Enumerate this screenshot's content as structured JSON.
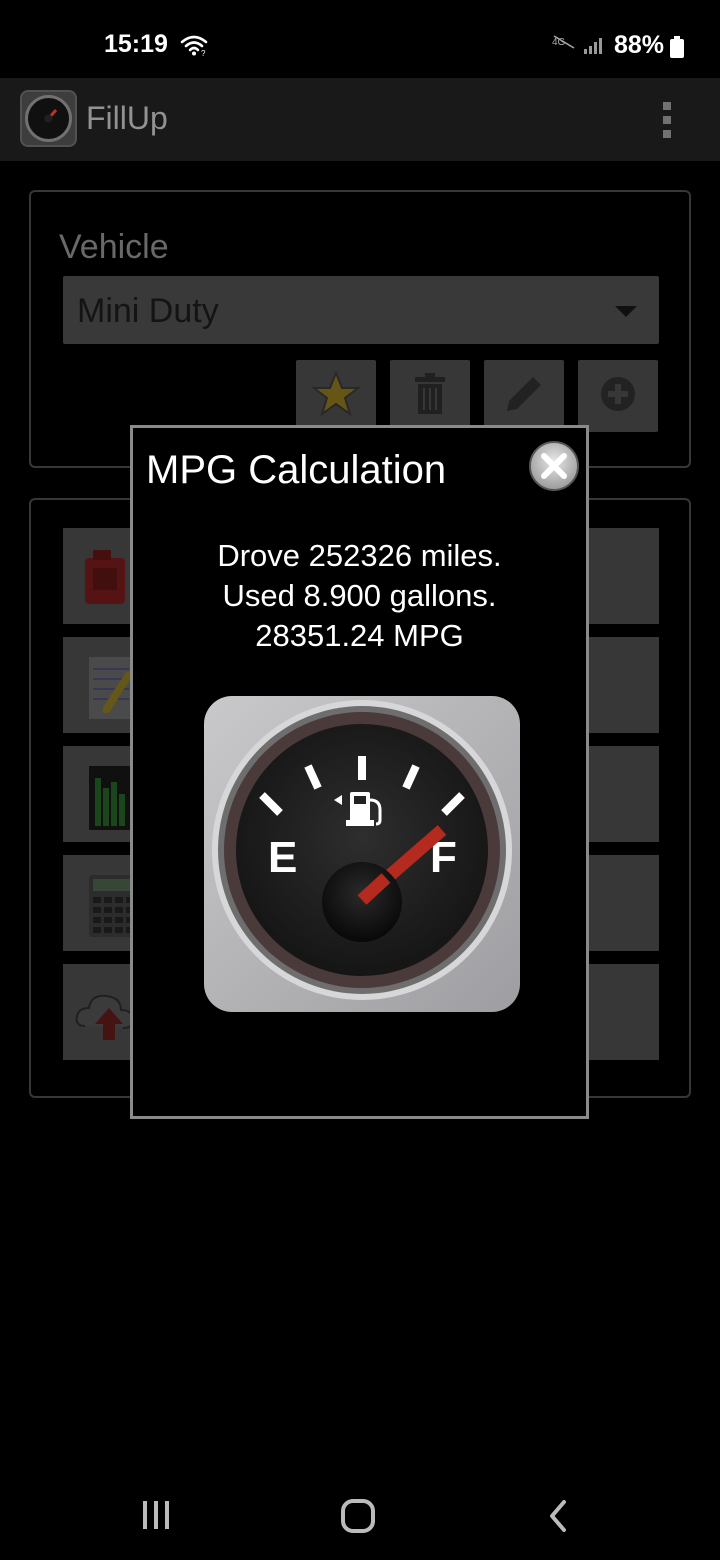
{
  "status_bar": {
    "time": "15:19",
    "battery": "88%"
  },
  "app_bar": {
    "title": "FillUp",
    "logo_icon": "fuel-gauge-icon",
    "overflow_icon": "more-vert-icon"
  },
  "vehicle": {
    "label": "Vehicle",
    "selected": "Mini Duty",
    "actions": [
      "star-icon",
      "trash-icon",
      "pencil-icon",
      "add-icon"
    ]
  },
  "menu": {
    "items": [
      "gas-can-icon",
      "notepad-icon",
      "bar-chart-icon",
      "calculator-icon",
      "cloud-upload-icon"
    ]
  },
  "dialog": {
    "title": "MPG Calculation",
    "lines": [
      "Drove 252326 miles.",
      "Used 8.900 gallons.",
      "28351.24 MPG"
    ],
    "image_icon": "fuel-gauge-icon",
    "close_icon": "close-icon"
  },
  "nav_bar": {
    "items": [
      "recent-apps-icon",
      "home-icon",
      "back-icon"
    ]
  }
}
